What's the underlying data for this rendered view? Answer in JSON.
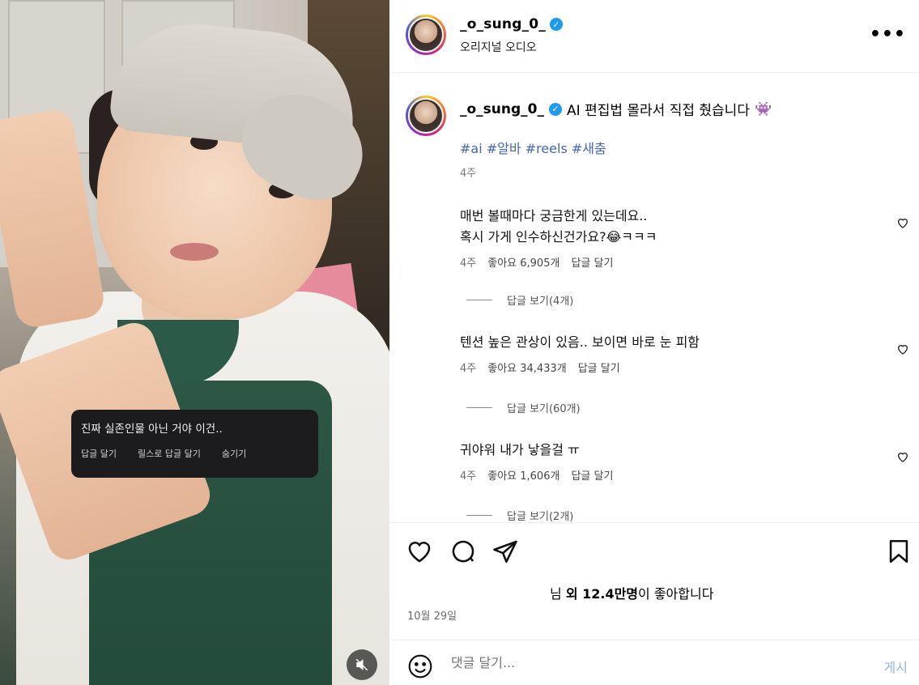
{
  "video": {
    "overlay_comment": "진짜 실존인물 아닌 거야 이건..",
    "overlay_actions": [
      "답글 달기",
      "릴스로 답글 달기",
      "숨기기"
    ],
    "mute_icon": "speaker-muted-icon"
  },
  "header": {
    "username": "_o_sung_0_",
    "subtitle": "오리지널 오디오",
    "more_label": "•••"
  },
  "caption": {
    "username": "_o_sung_0_",
    "text": "AI 편집법 몰라서 직접 췄습니다",
    "emoji": "👾",
    "hashtags": "#ai #알바 #reels #새춤",
    "time": "4주"
  },
  "comments": [
    {
      "text": "매번 볼때마다 궁금한게 있는데요..\n혹시 가게 인수하신건가요?😂ㅋㅋㅋ",
      "time": "4주",
      "likes": "좋아요 6,905개",
      "reply": "답글 달기",
      "view_replies": "답글 보기(4개)"
    },
    {
      "text": "텐션 높은 관상이 있음.. 보이면 바로 눈 피함",
      "time": "4주",
      "likes": "좋아요 34,433개",
      "reply": "답글 달기",
      "view_replies": "답글 보기(60개)"
    },
    {
      "text": "귀야워 내가 낳을걸 ㅠ",
      "time": "4주",
      "likes": "좋아요 1,606개",
      "reply": "답글 달기",
      "view_replies": "답글 보기(2개)"
    }
  ],
  "likes_line": {
    "prefix": "님 ",
    "bold": "외 12.4만명",
    "suffix": "이 좋아합니다"
  },
  "date": "10월 29일",
  "comment_input": {
    "placeholder": "댓글 달기...",
    "post_label": "게시"
  },
  "colors": {
    "hashtag": "#4467b2",
    "verified": "#1d9bf0",
    "post_button": "#8fb7e8"
  }
}
